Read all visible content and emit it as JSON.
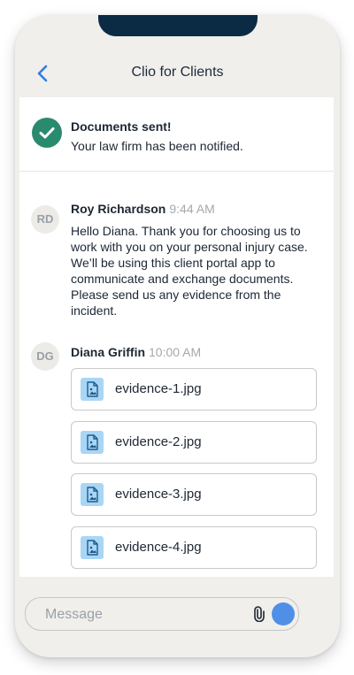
{
  "header": {
    "title": "Clio for Clients"
  },
  "banner": {
    "title": "Documents sent!",
    "subtitle": "Your law firm has been notified."
  },
  "messages": [
    {
      "initials": "RD",
      "name": "Roy Richardson",
      "time": "9:44 AM",
      "text": "Hello Diana. Thank you for choosing us to work with you on your personal injury case. We’ll be using this client portal app to communicate and exchange documents. Please send us any evidence from the incident."
    },
    {
      "initials": "DG",
      "name": "Diana Griffin",
      "time": "10:00 AM",
      "files": [
        "evidence-1.jpg",
        "evidence-2.jpg",
        "evidence-3.jpg",
        "evidence-4.jpg"
      ]
    }
  ],
  "composer": {
    "placeholder": "Message"
  },
  "colors": {
    "accent": "#4f8fe6",
    "success": "#2a8a6e",
    "file_icon_bg": "#a9d6f5"
  }
}
